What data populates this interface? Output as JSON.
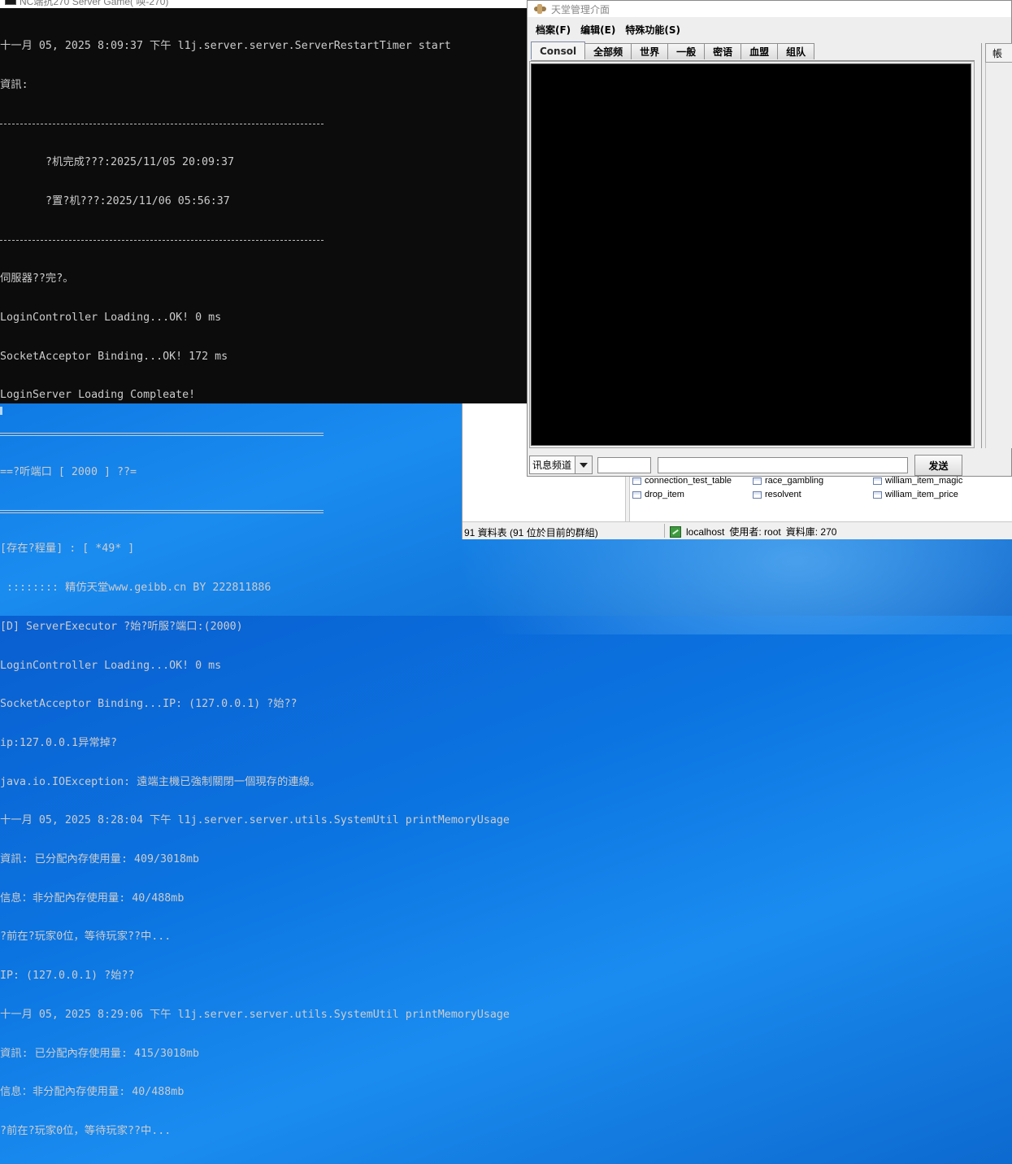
{
  "console": {
    "title": "NC端抗270 Server Game(  唤-270)",
    "lines": [
      "十一月 05, 2025 8:09:37 下午 l1j.server.server.ServerRestartTimer start",
      "資訊:",
      "",
      "       ?机完成???:2025/11/05 20:09:37",
      "       ?置?机???:2025/11/06 05:56:37",
      "",
      "伺服器??完?。",
      "LoginController Loading...OK! 0 ms",
      "SocketAcceptor Binding...OK! 172 ms",
      "LoginServer Loading Compleate!",
      "",
      "==?听端口 [ 2000 ] ??=",
      "",
      "[存在?程量] : [ *49* ]",
      " :::::::: 精仿天堂www.geibb.cn BY 222811886",
      "[D] ServerExecutor ?始?听服?端口:(2000)",
      "LoginController Loading...OK! 0 ms",
      "SocketAcceptor Binding...IP: (127.0.0.1) ?始??",
      "ip:127.0.0.1异常掉?",
      "java.io.IOException: 遠端主機已強制關閉一個現存的連線。",
      "十一月 05, 2025 8:28:04 下午 l1j.server.server.utils.SystemUtil printMemoryUsage",
      "資訊: 已分配內存使用量: 409/3018mb",
      "信息：非分配內存使用量: 40/488mb",
      "?前在?玩家0位，等待玩家??中...",
      "IP: (127.0.0.1) ?始??",
      "十一月 05, 2025 8:29:06 下午 l1j.server.server.utils.SystemUtil printMemoryUsage",
      "資訊: 已分配內存使用量: 415/3018mb",
      "信息：非分配內存使用量: 40/488mb",
      "?前在?玩家0位，等待玩家??中..."
    ]
  },
  "app": {
    "title": "天堂管理介面",
    "menu": [
      "档案(F)",
      "编辑(E)",
      "特殊功能(S)"
    ],
    "tabs": [
      "Consol",
      "全部频",
      "世界",
      "一般",
      "密语",
      "血盟",
      "组队"
    ],
    "active_tab": "Consol",
    "right_header": "帳",
    "channel_select": "讯息频道",
    "send_label": "发送"
  },
  "db_tool": {
    "tables": [
      {
        "name": "connection_test_table",
        "col": 0,
        "row": 0
      },
      {
        "name": "race_gambling",
        "col": 1,
        "row": 0
      },
      {
        "name": "william_item_magic",
        "col": 2,
        "row": 0
      },
      {
        "name": "drop_item",
        "col": 0,
        "row": 1
      },
      {
        "name": "resolvent",
        "col": 1,
        "row": 1
      },
      {
        "name": "william_item_price",
        "col": 2,
        "row": 1
      }
    ],
    "status_left": "91 資料表 (91 位於目前的群組)",
    "status_host": "localhost",
    "status_user": "使用者: root",
    "status_db": "資料庫: 270"
  }
}
